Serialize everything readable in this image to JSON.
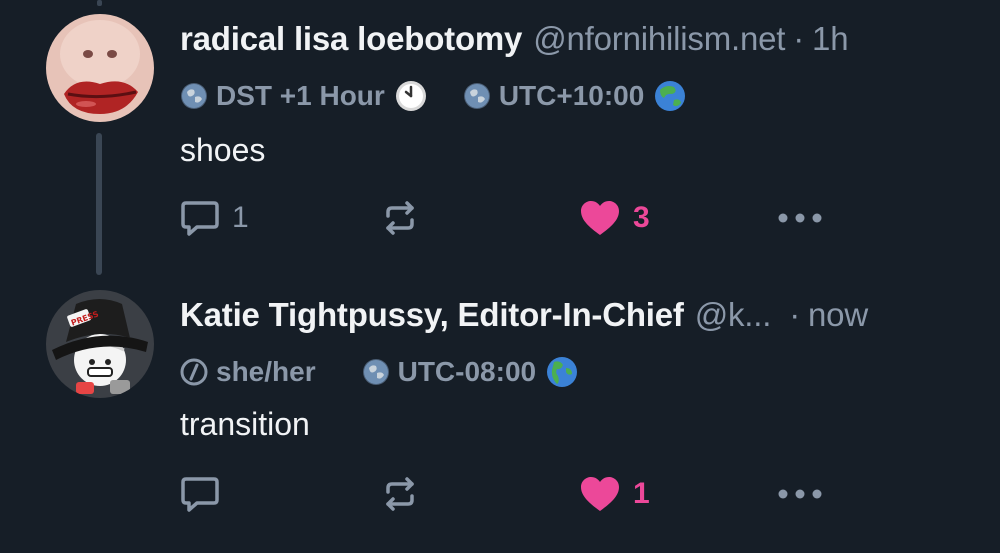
{
  "posts": [
    {
      "display_name": "radical lisa loebotomy",
      "handle": "@nfornihilism.net",
      "separator": "·",
      "time": "1h",
      "avatar_icon": "lips-avatar",
      "meta": [
        {
          "icon": "globe-icon",
          "text": "DST +1 Hour",
          "emoji": "clock-emoji"
        },
        {
          "icon": "globe-icon",
          "text": "UTC+10:00",
          "emoji": "earth-asia-emoji"
        }
      ],
      "text": "shoes",
      "reply_count": "1",
      "like_count": "3"
    },
    {
      "display_name": "Katie Tightpussy, Editor-In-Chief",
      "handle": "@k...",
      "separator": "·",
      "time": "now",
      "avatar_icon": "press-hat-avatar",
      "meta": [
        {
          "icon": "pronoun-icon",
          "text": "she/her"
        },
        {
          "icon": "globe-icon",
          "text": "UTC-08:00",
          "emoji": "earth-americas-emoji"
        }
      ],
      "text": "transition",
      "reply_count": "",
      "like_count": "1"
    }
  ],
  "colors": {
    "background": "#161e27",
    "muted": "#8b98a9",
    "like": "#ec4899",
    "thread_line": "#3a4654"
  }
}
